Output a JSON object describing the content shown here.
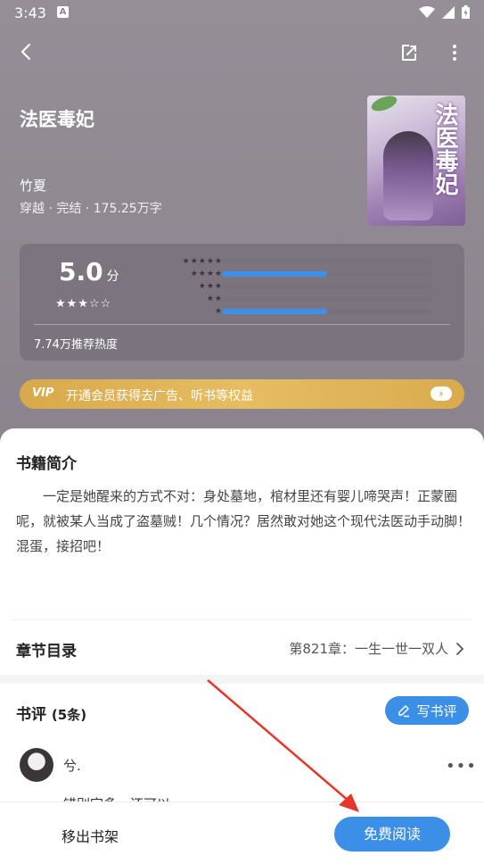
{
  "status_bar": {
    "time": "3:43",
    "app_badge": "A"
  },
  "book": {
    "title": "法医毒妃",
    "author": "竹夏",
    "genre": "穿越",
    "sep1": "·",
    "state": "完结",
    "sep2": "·",
    "words": "175.25万字",
    "cover_text": "法医毒妃"
  },
  "rating": {
    "score": "5.0",
    "unit": "分",
    "stars": "★★★☆☆",
    "distribution": [
      {
        "stars": "★★★★★",
        "fraction": 0.0
      },
      {
        "stars": "★★★★",
        "fraction": 0.5
      },
      {
        "stars": "★★★",
        "fraction": 0.0
      },
      {
        "stars": "★★",
        "fraction": 0.0
      },
      {
        "stars": "★",
        "fraction": 0.5
      }
    ],
    "heat": "7.74万推荐热度"
  },
  "vip": {
    "logo": "VIP",
    "text": "开通会员获得去广告、听书等权益",
    "go": "›"
  },
  "intro": {
    "heading": "书籍简介",
    "text": "一定是她醒来的方式不对：身处墓地，棺材里还有婴儿啼哭声！正蒙圈呢，就被某人当成了盗墓贼！几个情况？居然敢对她这个现代法医动手动脚！混蛋，接招吧！"
  },
  "toc": {
    "heading": "章节目录",
    "latest": "第821章：一生一世一双人"
  },
  "reviews": {
    "heading": "书评",
    "count": "(5条)",
    "write_label": "写书评",
    "items": [
      {
        "user": "兮.",
        "text": "错别字多，还可以"
      }
    ]
  },
  "bottom_bar": {
    "remove_label": "移出书架",
    "read_label": "免费阅读"
  },
  "colors": {
    "accent": "#3b8fe6",
    "vip_gold": "#e0b25a",
    "annotation_arrow": "#e8352b"
  }
}
